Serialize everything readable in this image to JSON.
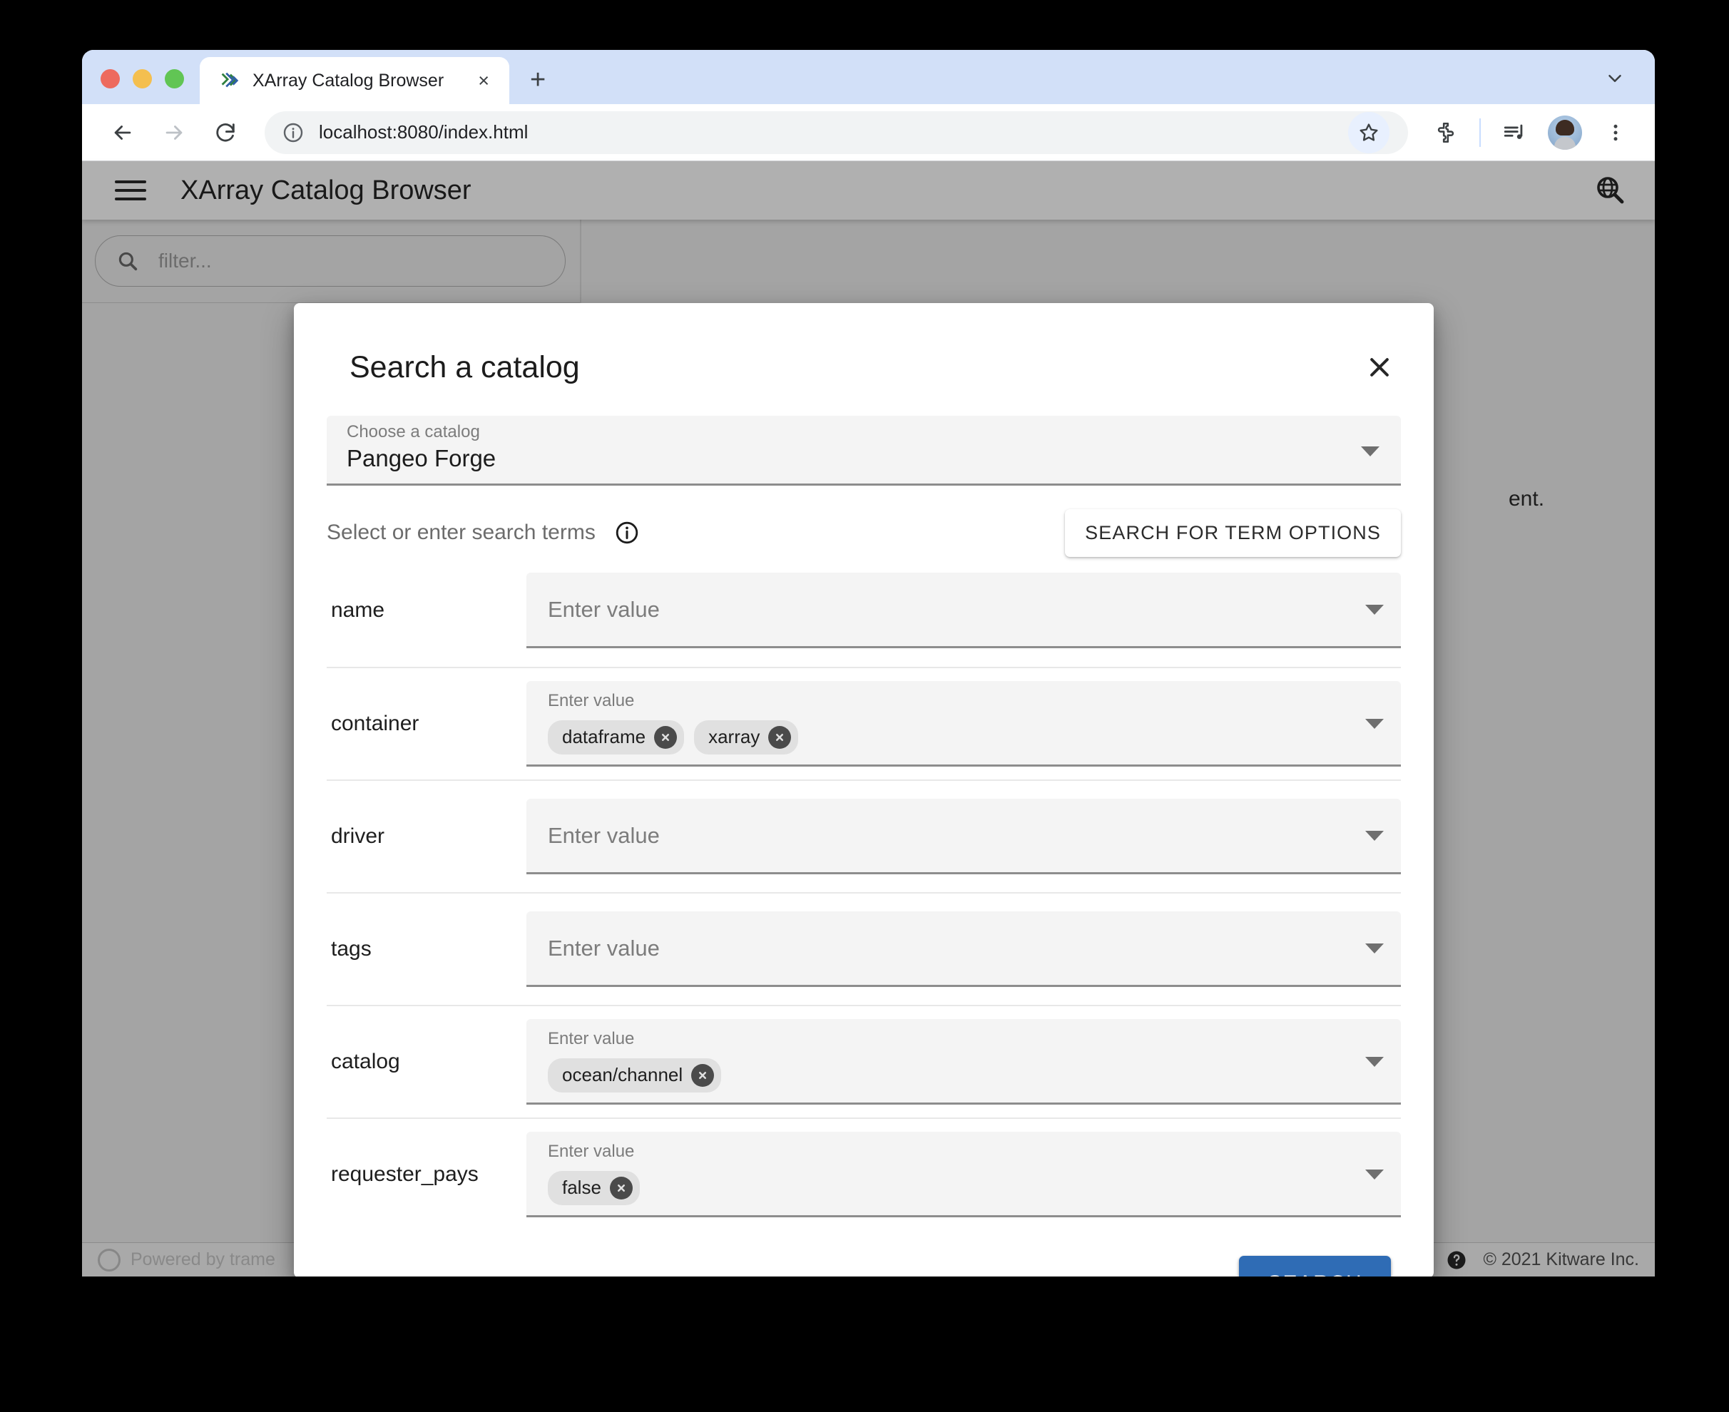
{
  "browser": {
    "tab": {
      "title": "XArray Catalog Browser",
      "favicon": "xarray-logo-icon",
      "close": "×"
    },
    "new_tab": "+",
    "omnibox": {
      "url": "localhost:8080/index.html",
      "info_icon": "site-info-icon"
    },
    "toolbar_icons": [
      "back-arrow-icon",
      "forward-arrow-icon",
      "reload-icon",
      "bookmark-star-icon",
      "extensions-puzzle-icon",
      "media-control-icon",
      "profile-avatar",
      "chrome-menu-icon"
    ]
  },
  "app": {
    "title": "XArray Catalog Browser",
    "menu_icon": "hamburger-menu-icon",
    "catalog_search_icon": "globe-search-icon",
    "sidebar": {
      "filter_placeholder": "filter..."
    },
    "content": {
      "visible_text": "ent."
    },
    "footer": {
      "powered_by": "Powered by trame",
      "copyright": "© 2021 Kitware Inc.",
      "help_icon": "help-circle-icon"
    }
  },
  "dialog": {
    "title": "Search a catalog",
    "close_icon": "close-icon",
    "catalog_select": {
      "label": "Choose a catalog",
      "value": "Pangeo Forge",
      "caret": "chevron-down-icon"
    },
    "terms_label": "Select or enter search terms",
    "terms_info_icon": "info-icon",
    "term_options_button": "SEARCH FOR TERM OPTIONS",
    "submit_button": "SEARCH",
    "accent_color": "#2f6cb5",
    "fields": [
      {
        "name": "name",
        "placeholder": "Enter value",
        "chips": []
      },
      {
        "name": "container",
        "placeholder": "Enter value",
        "chips": [
          "dataframe",
          "xarray"
        ]
      },
      {
        "name": "driver",
        "placeholder": "Enter value",
        "chips": []
      },
      {
        "name": "tags",
        "placeholder": "Enter value",
        "chips": []
      },
      {
        "name": "catalog",
        "placeholder": "Enter value",
        "chips": [
          "ocean/channel"
        ]
      },
      {
        "name": "requester_pays",
        "placeholder": "Enter value",
        "chips": [
          "false"
        ]
      }
    ]
  }
}
